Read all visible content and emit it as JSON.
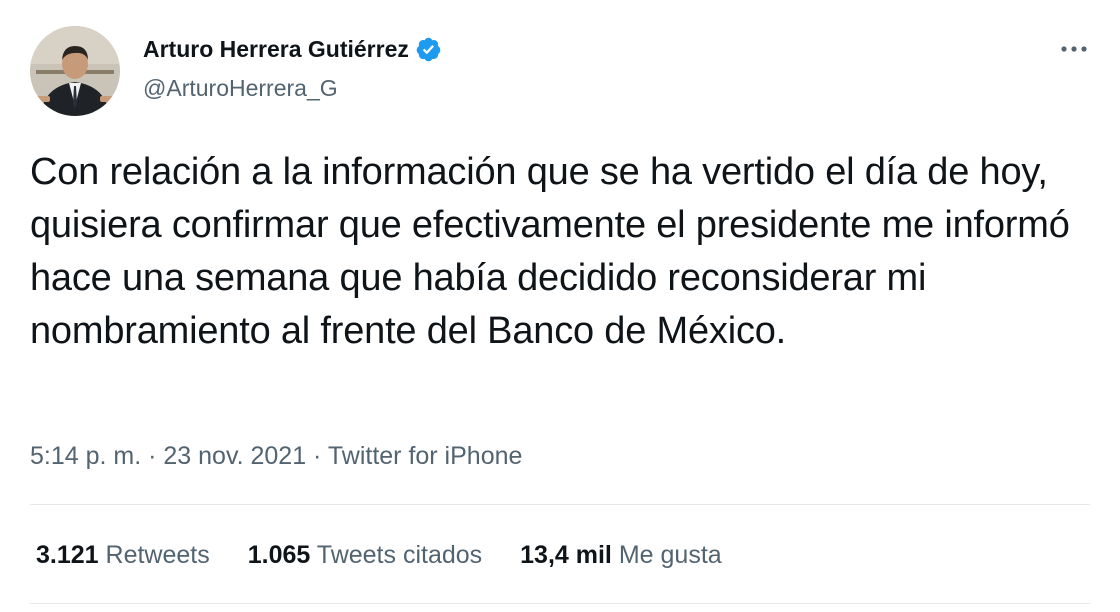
{
  "tweet": {
    "author": {
      "display_name": "Arturo Herrera Gutiérrez",
      "handle": "@ArturoHerrera_G",
      "verified": true,
      "avatar_icon": "profile-photo"
    },
    "text": "Con relación a la información que se ha vertido el día de hoy, quisiera confirmar que efectivamente el presidente me informó hace una semana que había decidido reconsiderar mi nombramiento al frente del Banco de México.",
    "time": "5:14 p. m.",
    "separator": " · ",
    "date": "23 nov. 2021",
    "source": "Twitter for iPhone",
    "stats": {
      "retweets_count": "3.121",
      "retweets_label": "Retweets",
      "quotes_count": "1.065",
      "quotes_label": "Tweets citados",
      "likes_count": "13,4 mil",
      "likes_label": "Me gusta"
    }
  },
  "icons": {
    "verified": "verified-badge-icon",
    "more": "more-options-icon"
  },
  "colors": {
    "text_primary": "#0f1419",
    "text_secondary": "#536471",
    "verified_blue": "#1d9bf0",
    "divider": "#e5e8eb"
  }
}
